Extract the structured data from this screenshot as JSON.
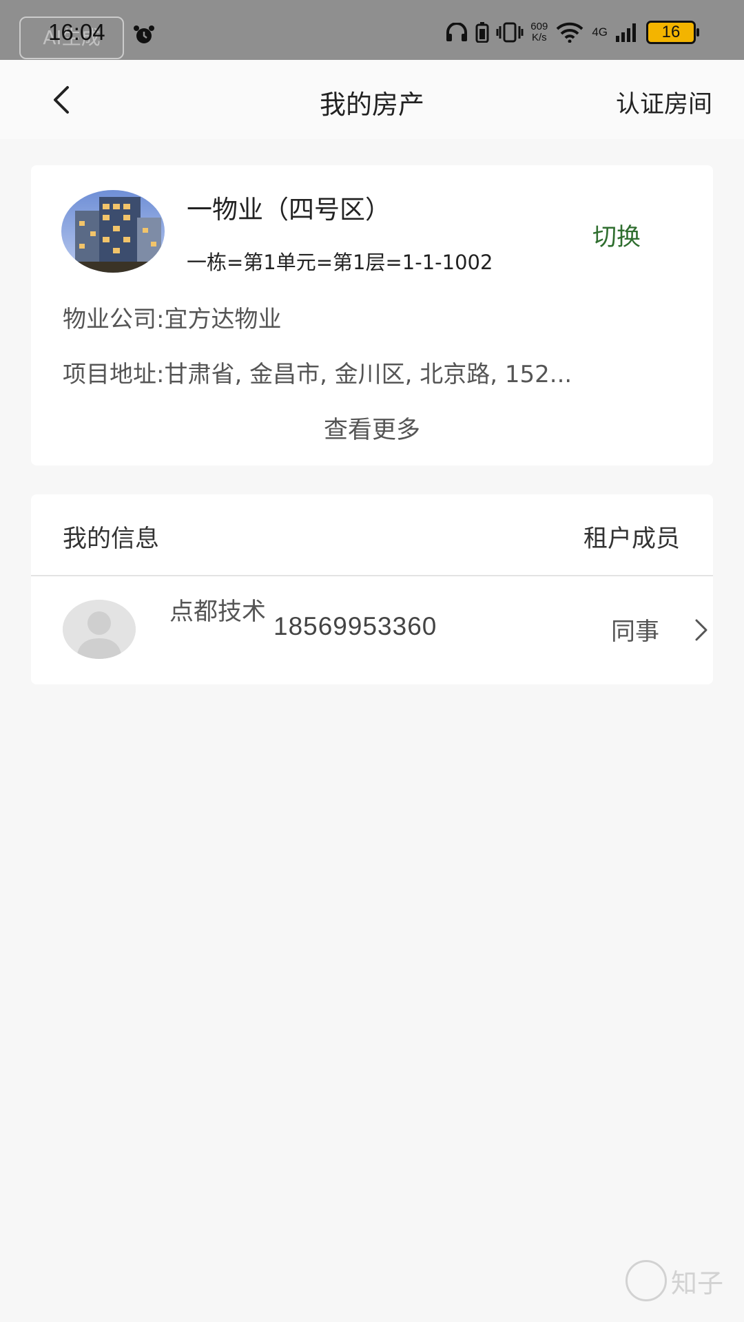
{
  "status_bar": {
    "time": "16:04",
    "ai_badge": "AI生成",
    "net_speed_value": "609",
    "net_speed_unit": "K/s",
    "network": "4G",
    "battery": "16"
  },
  "nav": {
    "title": "我的房产",
    "action": "认证房间"
  },
  "property": {
    "name": "一物业（四号区）",
    "unit": "一栋=第1单元=第1层=1-1-1002",
    "switch_label": "切换",
    "company": "物业公司:宜方达物业",
    "address": "项目地址:甘肃省, 金昌市, 金川区, 北京路, 152...",
    "more_label": "查看更多"
  },
  "info": {
    "title": "我的信息",
    "members_label": "租户成员",
    "members": [
      {
        "name": "点都技术",
        "phone": "18569953360",
        "relation": "同事"
      }
    ]
  },
  "watermark": "知子",
  "colors": {
    "accent": "#2f6e2f",
    "status_bar": "#8f8f8f",
    "battery": "#f3b400"
  }
}
